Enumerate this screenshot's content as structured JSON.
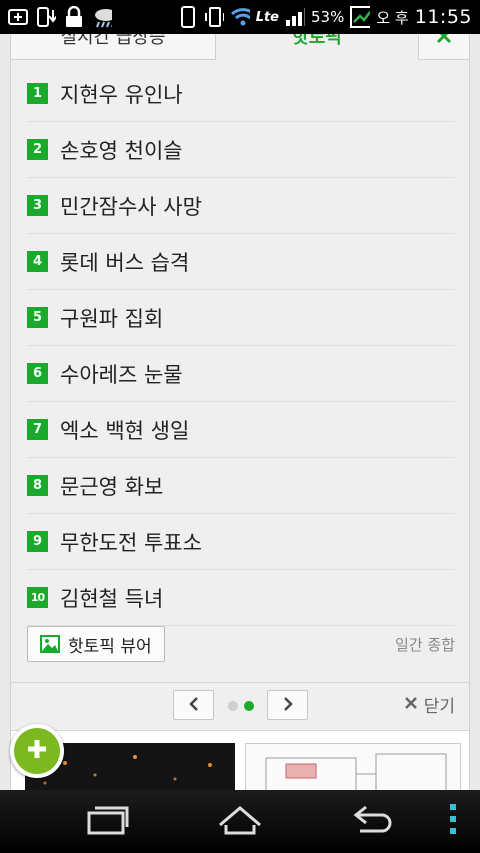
{
  "status": {
    "battery": "53%",
    "network": "Lte",
    "ampm": "오 후",
    "time": "11:55"
  },
  "tabs": {
    "left": "실시간 급상승",
    "active": "핫토픽",
    "close_icon": "close-icon"
  },
  "topics": [
    {
      "rank": "1",
      "title": "지현우 유인나"
    },
    {
      "rank": "2",
      "title": "손호영 천이슬"
    },
    {
      "rank": "3",
      "title": "민간잠수사 사망"
    },
    {
      "rank": "4",
      "title": "롯데 버스 습격"
    },
    {
      "rank": "5",
      "title": "구원파 집회"
    },
    {
      "rank": "6",
      "title": "수아레즈 눈물"
    },
    {
      "rank": "7",
      "title": "엑소 백현 생일"
    },
    {
      "rank": "8",
      "title": "문근영 화보"
    },
    {
      "rank": "9",
      "title": "무한도전 투표소"
    },
    {
      "rank": "10",
      "title": "김현철 득녀"
    }
  ],
  "viewer": {
    "button_label": "핫토픽 뷰어",
    "period": "일간 종합"
  },
  "pager": {
    "close_label": "닫기"
  },
  "colors": {
    "accent": "#19a92b",
    "fab": "#7cb81f"
  }
}
